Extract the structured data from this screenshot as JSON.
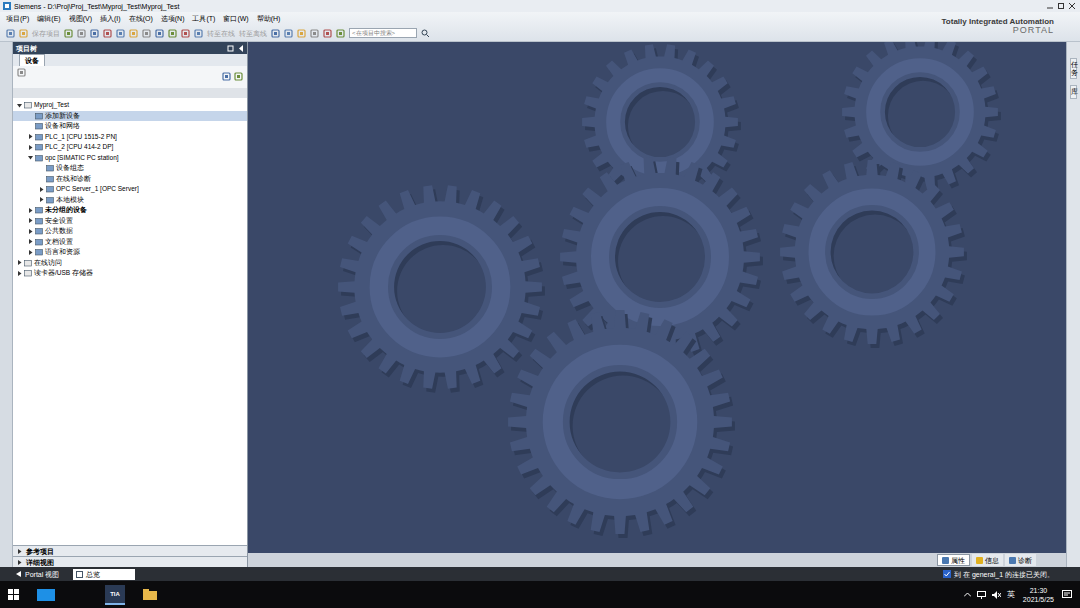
{
  "window": {
    "title": "Siemens - D:\\Proj\\Proj_Test\\Myproj_Test\\Myproj_Test"
  },
  "menu": [
    {
      "label": "项目(P)"
    },
    {
      "label": "编辑(E)"
    },
    {
      "label": "视图(V)"
    },
    {
      "label": "插入(I)"
    },
    {
      "label": "在线(O)"
    },
    {
      "label": "选项(N)"
    },
    {
      "label": "工具(T)"
    },
    {
      "label": "窗口(W)"
    },
    {
      "label": "帮助(H)"
    }
  ],
  "brand": {
    "line1": "Totally Integrated Automation",
    "line2": "PORTAL"
  },
  "toolbar": [
    {
      "label": "保存项目",
      "disabled": true
    },
    {
      "label": "转至在线",
      "disabled": true
    },
    {
      "label": "转至离线",
      "disabled": true
    }
  ],
  "search": {
    "placeholder": "<在项目中搜索>"
  },
  "project_tree": {
    "title": "项目树",
    "tabs": [
      {
        "label": "设备",
        "selected": true
      }
    ],
    "items": [
      {
        "label": "Myproj_Test",
        "level": 0,
        "has_children": true,
        "expanded": true,
        "selected": false,
        "bold": false
      },
      {
        "label": "添加新设备",
        "level": 1,
        "has_children": false,
        "expanded": false,
        "selected": true,
        "bold": false
      },
      {
        "label": "设备和网络",
        "level": 1,
        "has_children": false,
        "expanded": false,
        "selected": false,
        "bold": false
      },
      {
        "label": "PLC_1 [CPU 1515-2 PN]",
        "level": 1,
        "has_children": true,
        "expanded": false,
        "selected": false,
        "bold": false
      },
      {
        "label": "PLC_2 [CPU 414-2 DP]",
        "level": 1,
        "has_children": true,
        "expanded": false,
        "selected": false,
        "bold": false
      },
      {
        "label": "opc [SIMATIC PC station]",
        "level": 1,
        "has_children": true,
        "expanded": true,
        "selected": false,
        "bold": false
      },
      {
        "label": "设备组态",
        "level": 2,
        "has_children": false,
        "expanded": false,
        "selected": false,
        "bold": false
      },
      {
        "label": "在线和诊断",
        "level": 2,
        "has_children": false,
        "expanded": false,
        "selected": false,
        "bold": false
      },
      {
        "label": "OPC Server_1 [OPC Server]",
        "level": 2,
        "has_children": true,
        "expanded": false,
        "selected": false,
        "bold": false
      },
      {
        "label": "本地模块",
        "level": 2,
        "has_children": true,
        "expanded": false,
        "selected": false,
        "bold": false
      },
      {
        "label": "未分组的设备",
        "level": 1,
        "has_children": true,
        "expanded": false,
        "selected": false,
        "bold": true
      },
      {
        "label": "安全设置",
        "level": 1,
        "has_children": true,
        "expanded": false,
        "selected": false,
        "bold": false
      },
      {
        "label": "公共数据",
        "level": 1,
        "has_children": true,
        "expanded": false,
        "selected": false,
        "bold": false
      },
      {
        "label": "文档设置",
        "level": 1,
        "has_children": true,
        "expanded": false,
        "selected": false,
        "bold": false
      },
      {
        "label": "语言和资源",
        "level": 1,
        "has_children": true,
        "expanded": false,
        "selected": false,
        "bold": false
      },
      {
        "label": "在线访问",
        "level": 0,
        "has_children": true,
        "expanded": false,
        "selected": false,
        "bold": false
      },
      {
        "label": "读卡器/USB 存储器",
        "level": 0,
        "has_children": true,
        "expanded": false,
        "selected": false,
        "bold": false
      }
    ],
    "bottom_sections": [
      {
        "label": "参考项目",
        "expanded": false
      },
      {
        "label": "详细视图",
        "expanded": false
      }
    ]
  },
  "right_tabs": [
    {
      "label": "任务"
    },
    {
      "label": "库"
    }
  ],
  "inspector_tabs": [
    {
      "label": "属性",
      "selected": true
    },
    {
      "label": "信息",
      "selected": false
    },
    {
      "label": "诊断",
      "selected": false
    }
  ],
  "status_bar": {
    "portal_view": "Portal 视图",
    "overview_tab": "总览",
    "message": "到 在 general_1 的连接已关闭。"
  },
  "taskbar": {
    "app_label": "TIA",
    "ime": "英",
    "time": "21:30",
    "date": "2021/5/25"
  }
}
